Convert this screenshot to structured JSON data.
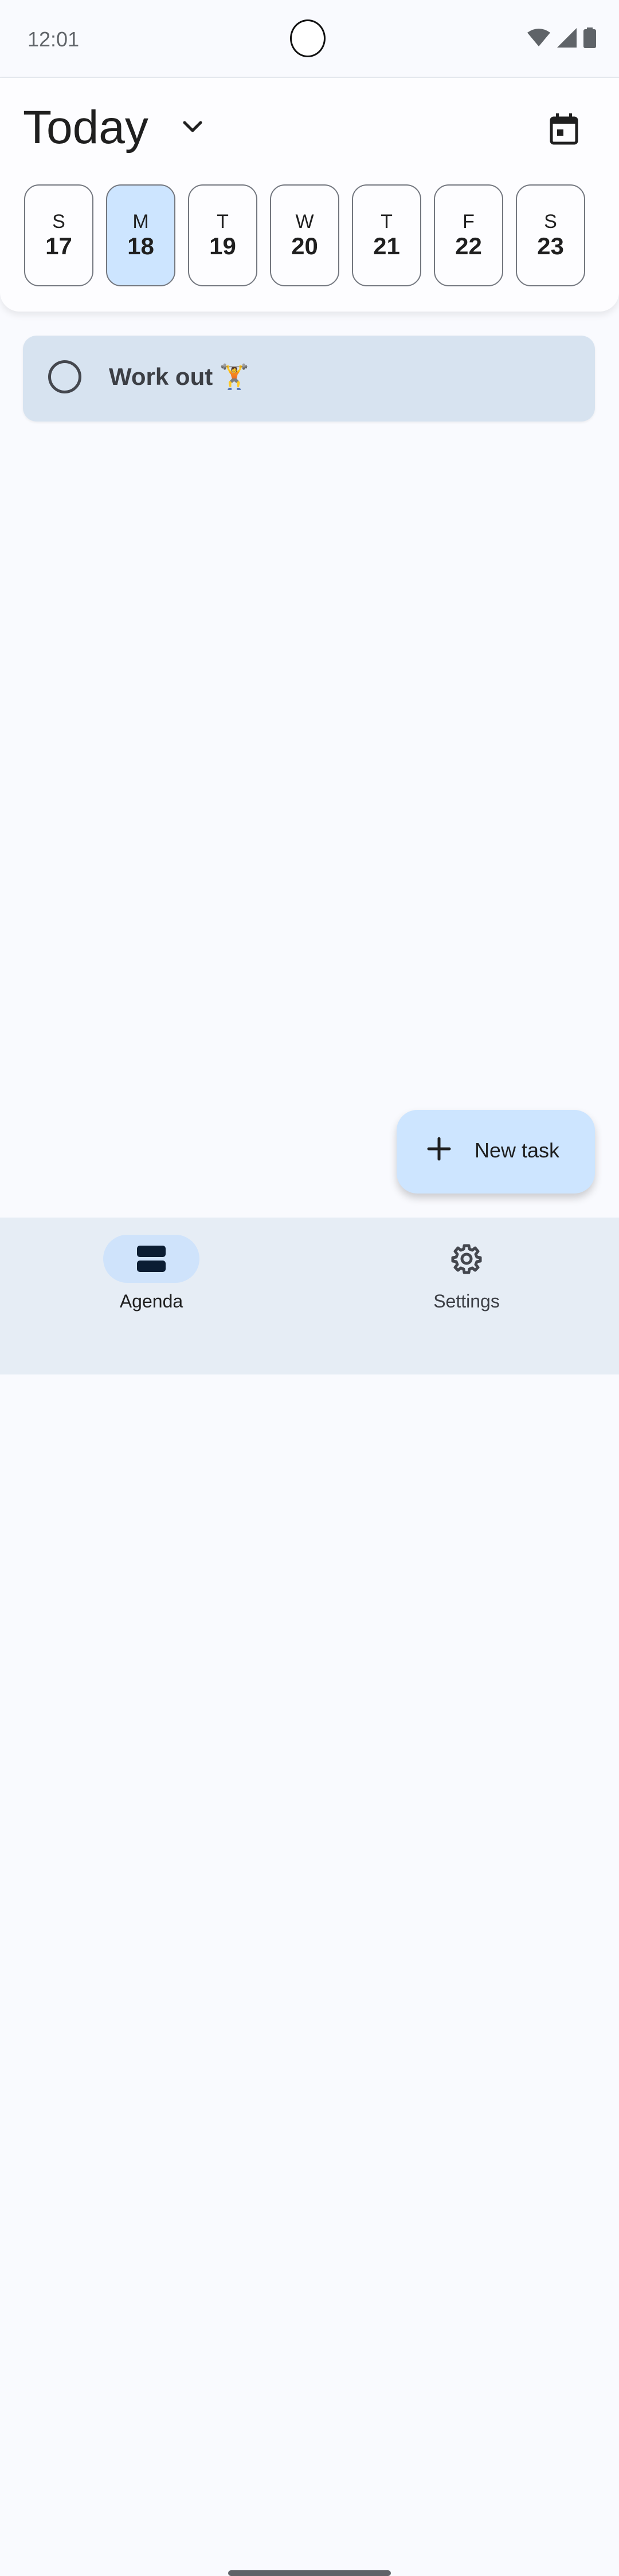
{
  "status_bar": {
    "time": "12:01"
  },
  "header": {
    "title": "Today",
    "days": [
      {
        "letter": "S",
        "number": "17",
        "selected": false
      },
      {
        "letter": "M",
        "number": "18",
        "selected": true
      },
      {
        "letter": "T",
        "number": "19",
        "selected": false
      },
      {
        "letter": "W",
        "number": "20",
        "selected": false
      },
      {
        "letter": "T",
        "number": "21",
        "selected": false
      },
      {
        "letter": "F",
        "number": "22",
        "selected": false
      },
      {
        "letter": "S",
        "number": "23",
        "selected": false
      }
    ]
  },
  "tasks": [
    {
      "label": "Work out 🏋️",
      "done": false
    }
  ],
  "fab": {
    "label": "New task"
  },
  "nav": {
    "items": [
      {
        "label": "Agenda",
        "icon": "agenda-icon",
        "active": true
      },
      {
        "label": "Settings",
        "icon": "gear-icon",
        "active": false
      }
    ]
  },
  "colors": {
    "accent": "#CDE5FF",
    "task_card": "#D7E3F0",
    "background": "#F9FAFE",
    "nav_bar": "#E6EDF5"
  }
}
